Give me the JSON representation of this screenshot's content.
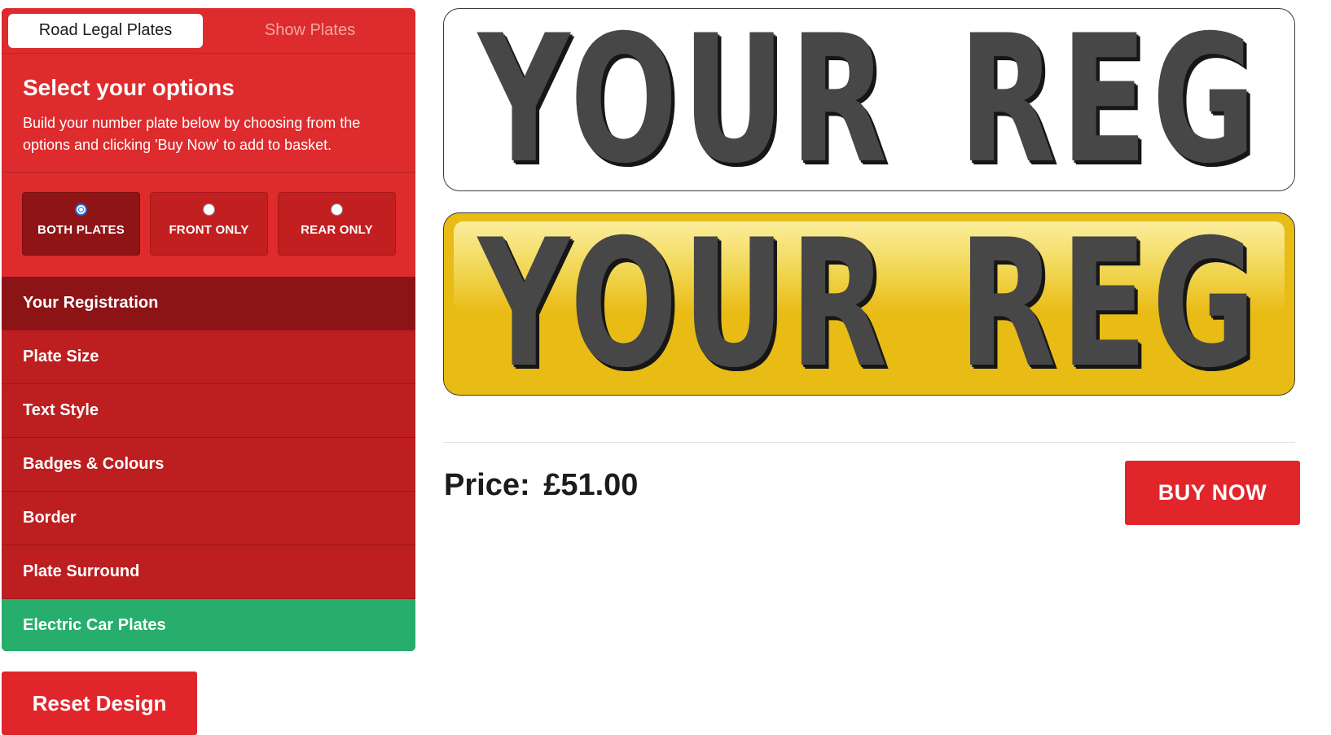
{
  "tabs": [
    {
      "label": "Road Legal Plates",
      "active": true
    },
    {
      "label": "Show Plates",
      "active": false
    }
  ],
  "intro": {
    "title": "Select your options",
    "description": "Build your number plate below by choosing from the options and clicking 'Buy Now' to add to basket."
  },
  "plate_choice": {
    "selected": "BOTH PLATES",
    "options": [
      "BOTH PLATES",
      "FRONT ONLY",
      "REAR ONLY"
    ]
  },
  "menu": [
    "Your Registration",
    "Plate Size",
    "Text Style",
    "Badges & Colours",
    "Border",
    "Plate Surround",
    "Electric Car Plates"
  ],
  "reset_label": "Reset Design",
  "plates": {
    "front_text": "YOUR REG",
    "rear_text": "YOUR REG"
  },
  "price": {
    "label": "Price:",
    "value": "£51.00"
  },
  "buy_label": "BUY NOW",
  "colors": {
    "brand_red": "#de2b2d",
    "menu_red": "#bd1e20",
    "menu_active": "#8c1416",
    "electric_green": "#27ad6c",
    "rear_plate_yellow": "#e9bb15"
  }
}
